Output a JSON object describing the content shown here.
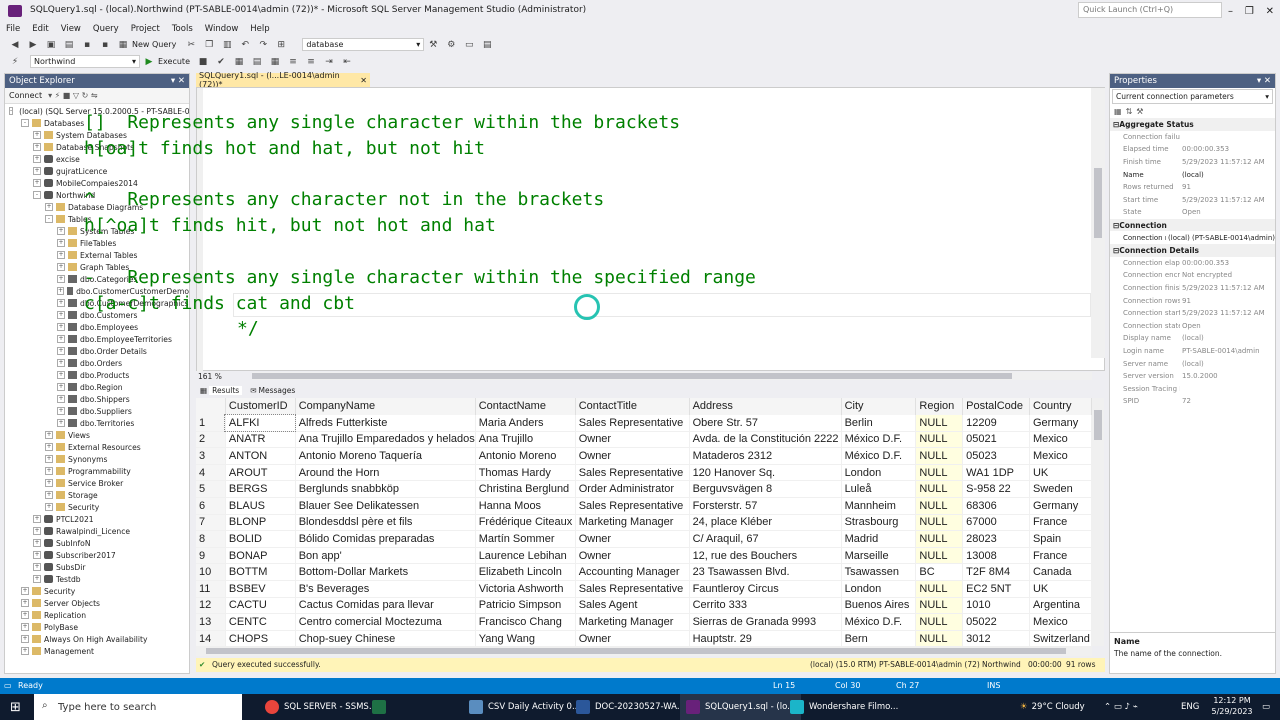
{
  "window": {
    "title": "SQLQuery1.sql - (local).Northwind (PT-SABLE-0014\\admin (72))* - Microsoft SQL Server Management Studio (Administrator)",
    "quick_launch_placeholder": "Quick Launch (Ctrl+Q)"
  },
  "menu": [
    "File",
    "Edit",
    "View",
    "Query",
    "Project",
    "Tools",
    "Window",
    "Help"
  ],
  "toolbar": {
    "new_query": "New Query",
    "database_combo": "database",
    "db_select": "Northwind",
    "execute": "Execute"
  },
  "object_explorer": {
    "title": "Object Explorer",
    "connect": "Connect",
    "tree": [
      {
        "label": "(local) (SQL Server 15.0.2000.5 - PT-SABLE-0014\\admin)",
        "level": 0,
        "exp": "-",
        "icon": "srv"
      },
      {
        "label": "Databases",
        "level": 1,
        "exp": "-",
        "icon": "fold"
      },
      {
        "label": "System Databases",
        "level": 2,
        "exp": "+",
        "icon": "fold"
      },
      {
        "label": "Database Snapshots",
        "level": 2,
        "exp": "+",
        "icon": "fold"
      },
      {
        "label": "excise",
        "level": 2,
        "exp": "+",
        "icon": "db"
      },
      {
        "label": "gujratLicence",
        "level": 2,
        "exp": "+",
        "icon": "db"
      },
      {
        "label": "MobileCompaies2014",
        "level": 2,
        "exp": "+",
        "icon": "db"
      },
      {
        "label": "Northwind",
        "level": 2,
        "exp": "-",
        "icon": "db"
      },
      {
        "label": "Database Diagrams",
        "level": 3,
        "exp": "+",
        "icon": "fold"
      },
      {
        "label": "Tables",
        "level": 3,
        "exp": "-",
        "icon": "fold"
      },
      {
        "label": "System Tables",
        "level": 4,
        "exp": "+",
        "icon": "fold"
      },
      {
        "label": "FileTables",
        "level": 4,
        "exp": "+",
        "icon": "fold"
      },
      {
        "label": "External Tables",
        "level": 4,
        "exp": "+",
        "icon": "fold"
      },
      {
        "label": "Graph Tables",
        "level": 4,
        "exp": "+",
        "icon": "fold"
      },
      {
        "label": "dbo.Categories",
        "level": 4,
        "exp": "+",
        "icon": "tbl"
      },
      {
        "label": "dbo.CustomerCustomerDemo",
        "level": 4,
        "exp": "+",
        "icon": "tbl"
      },
      {
        "label": "dbo.CustomerDemographics",
        "level": 4,
        "exp": "+",
        "icon": "tbl"
      },
      {
        "label": "dbo.Customers",
        "level": 4,
        "exp": "+",
        "icon": "tbl"
      },
      {
        "label": "dbo.Employees",
        "level": 4,
        "exp": "+",
        "icon": "tbl"
      },
      {
        "label": "dbo.EmployeeTerritories",
        "level": 4,
        "exp": "+",
        "icon": "tbl"
      },
      {
        "label": "dbo.Order Details",
        "level": 4,
        "exp": "+",
        "icon": "tbl"
      },
      {
        "label": "dbo.Orders",
        "level": 4,
        "exp": "+",
        "icon": "tbl"
      },
      {
        "label": "dbo.Products",
        "level": 4,
        "exp": "+",
        "icon": "tbl"
      },
      {
        "label": "dbo.Region",
        "level": 4,
        "exp": "+",
        "icon": "tbl"
      },
      {
        "label": "dbo.Shippers",
        "level": 4,
        "exp": "+",
        "icon": "tbl"
      },
      {
        "label": "dbo.Suppliers",
        "level": 4,
        "exp": "+",
        "icon": "tbl"
      },
      {
        "label": "dbo.Territories",
        "level": 4,
        "exp": "+",
        "icon": "tbl"
      },
      {
        "label": "Views",
        "level": 3,
        "exp": "+",
        "icon": "fold"
      },
      {
        "label": "External Resources",
        "level": 3,
        "exp": "+",
        "icon": "fold"
      },
      {
        "label": "Synonyms",
        "level": 3,
        "exp": "+",
        "icon": "fold"
      },
      {
        "label": "Programmability",
        "level": 3,
        "exp": "+",
        "icon": "fold"
      },
      {
        "label": "Service Broker",
        "level": 3,
        "exp": "+",
        "icon": "fold"
      },
      {
        "label": "Storage",
        "level": 3,
        "exp": "+",
        "icon": "fold"
      },
      {
        "label": "Security",
        "level": 3,
        "exp": "+",
        "icon": "fold"
      },
      {
        "label": "PTCL2021",
        "level": 2,
        "exp": "+",
        "icon": "db"
      },
      {
        "label": "Rawalpindi_Licence",
        "level": 2,
        "exp": "+",
        "icon": "db"
      },
      {
        "label": "SubInfoN",
        "level": 2,
        "exp": "+",
        "icon": "db"
      },
      {
        "label": "Subscriber2017",
        "level": 2,
        "exp": "+",
        "icon": "db"
      },
      {
        "label": "SubsDir",
        "level": 2,
        "exp": "+",
        "icon": "db"
      },
      {
        "label": "Testdb",
        "level": 2,
        "exp": "+",
        "icon": "db"
      },
      {
        "label": "Security",
        "level": 1,
        "exp": "+",
        "icon": "fold"
      },
      {
        "label": "Server Objects",
        "level": 1,
        "exp": "+",
        "icon": "fold"
      },
      {
        "label": "Replication",
        "level": 1,
        "exp": "+",
        "icon": "fold"
      },
      {
        "label": "PolyBase",
        "level": 1,
        "exp": "+",
        "icon": "fold"
      },
      {
        "label": "Always On High Availability",
        "level": 1,
        "exp": "+",
        "icon": "fold"
      },
      {
        "label": "Management",
        "level": 1,
        "exp": "+",
        "icon": "fold"
      }
    ]
  },
  "editor": {
    "tab_label": "SQLQuery1.sql - (l...LE-0014\\admin (72))*",
    "lines": [
      "[]  Represents any single character within the brackets",
      "h[oa]t finds hot and hat, but not hit",
      "",
      "^   Represents any character not in the brackets",
      "h[^oa]t finds hit, but not hot and hat",
      "",
      "-   Represents any single character within the specified range",
      "c[a-c]t finds cat and cbt",
      "*/"
    ],
    "zoom": "161 %"
  },
  "results": {
    "tab_results": "Results",
    "tab_messages": "Messages",
    "columns": [
      "CustomerID",
      "CompanyName",
      "ContactName",
      "ContactTitle",
      "Address",
      "City",
      "Region",
      "PostalCode",
      "Country"
    ],
    "rows": [
      [
        "1",
        "ALFKI",
        "Alfreds Futterkiste",
        "Maria Anders",
        "Sales Representative",
        "Obere Str. 57",
        "Berlin",
        "NULL",
        "12209",
        "Germany"
      ],
      [
        "2",
        "ANATR",
        "Ana Trujillo Emparedados y helados",
        "Ana Trujillo",
        "Owner",
        "Avda. de la Constitución 2222",
        "México D.F.",
        "NULL",
        "05021",
        "Mexico"
      ],
      [
        "3",
        "ANTON",
        "Antonio Moreno Taquería",
        "Antonio Moreno",
        "Owner",
        "Mataderos  2312",
        "México D.F.",
        "NULL",
        "05023",
        "Mexico"
      ],
      [
        "4",
        "AROUT",
        "Around the Horn",
        "Thomas Hardy",
        "Sales Representative",
        "120 Hanover Sq.",
        "London",
        "NULL",
        "WA1 1DP",
        "UK"
      ],
      [
        "5",
        "BERGS",
        "Berglunds snabbköp",
        "Christina Berglund",
        "Order Administrator",
        "Berguvsvägen  8",
        "Luleå",
        "NULL",
        "S-958 22",
        "Sweden"
      ],
      [
        "6",
        "BLAUS",
        "Blauer See Delikatessen",
        "Hanna Moos",
        "Sales Representative",
        "Forsterstr. 57",
        "Mannheim",
        "NULL",
        "68306",
        "Germany"
      ],
      [
        "7",
        "BLONP",
        "Blondesddsl père et fils",
        "Frédérique Citeaux",
        "Marketing Manager",
        "24, place Kléber",
        "Strasbourg",
        "NULL",
        "67000",
        "France"
      ],
      [
        "8",
        "BOLID",
        "Bólido Comidas preparadas",
        "Martín Sommer",
        "Owner",
        "C/ Araquil, 67",
        "Madrid",
        "NULL",
        "28023",
        "Spain"
      ],
      [
        "9",
        "BONAP",
        "Bon app'",
        "Laurence Lebihan",
        "Owner",
        "12, rue des Bouchers",
        "Marseille",
        "NULL",
        "13008",
        "France"
      ],
      [
        "10",
        "BOTTM",
        "Bottom-Dollar Markets",
        "Elizabeth Lincoln",
        "Accounting Manager",
        "23 Tsawassen Blvd.",
        "Tsawassen",
        "BC",
        "T2F 8M4",
        "Canada"
      ],
      [
        "11",
        "BSBEV",
        "B's Beverages",
        "Victoria Ashworth",
        "Sales Representative",
        "Fauntleroy Circus",
        "London",
        "NULL",
        "EC2 5NT",
        "UK"
      ],
      [
        "12",
        "CACTU",
        "Cactus Comidas para llevar",
        "Patricio Simpson",
        "Sales Agent",
        "Cerrito 333",
        "Buenos Aires",
        "NULL",
        "1010",
        "Argentina"
      ],
      [
        "13",
        "CENTC",
        "Centro comercial Moctezuma",
        "Francisco Chang",
        "Marketing Manager",
        "Sierras de Granada 9993",
        "México D.F.",
        "NULL",
        "05022",
        "Mexico"
      ],
      [
        "14",
        "CHOPS",
        "Chop-suey Chinese",
        "Yang Wang",
        "Owner",
        "Hauptstr. 29",
        "Bern",
        "NULL",
        "3012",
        "Switzerland"
      ]
    ]
  },
  "query_status": {
    "message": "Query executed successfully.",
    "server": "(local) (15.0 RTM)",
    "user": "PT-SABLE-0014\\admin (72)",
    "database": "Northwind",
    "elapsed": "00:00:00",
    "rows": "91 rows"
  },
  "properties": {
    "title": "Properties",
    "selector": "Current connection parameters",
    "sections": [
      {
        "name": "Aggregate Status",
        "items": [
          [
            "Connection failures",
            ""
          ],
          [
            "Elapsed time",
            "00:00:00.353"
          ],
          [
            "Finish time",
            "5/29/2023 11:57:12 AM"
          ],
          [
            "Name",
            "(local)"
          ],
          [
            "Rows returned",
            "91"
          ],
          [
            "Start time",
            "5/29/2023 11:57:12 AM"
          ],
          [
            "State",
            "Open"
          ]
        ]
      },
      {
        "name": "Connection",
        "items": [
          [
            "Connection name",
            "(local) (PT-SABLE-0014\\admin)"
          ]
        ]
      },
      {
        "name": "Connection Details",
        "items": [
          [
            "Connection elapsed",
            "00:00:00.353"
          ],
          [
            "Connection encryption",
            "Not encrypted"
          ],
          [
            "Connection finish time",
            "5/29/2023 11:57:12 AM"
          ],
          [
            "Connection rows returned",
            "91"
          ],
          [
            "Connection start time",
            "5/29/2023 11:57:12 AM"
          ],
          [
            "Connection state",
            "Open"
          ],
          [
            "Display name",
            "(local)"
          ],
          [
            "Login name",
            "PT-SABLE-0014\\admin"
          ],
          [
            "Server name",
            "(local)"
          ],
          [
            "Server version",
            "15.0.2000"
          ],
          [
            "Session Tracing ID",
            ""
          ],
          [
            "SPID",
            "72"
          ]
        ]
      }
    ],
    "desc_title": "Name",
    "desc_text": "The name of the connection."
  },
  "app_status": {
    "ready": "Ready",
    "ln": "Ln 15",
    "col": "Col 30",
    "ch": "Ch 27",
    "ins": "INS"
  },
  "taskbar": {
    "search_placeholder": "Type here to search",
    "apps": [
      "SQL SERVER - SSMS...",
      "CSV Daily Activity 0...",
      "DOC-20230527-WA...",
      "SQLQuery1.sql - (lo...",
      "Wondershare Filmo..."
    ],
    "weather": "29°C  Cloudy",
    "lang": "ENG",
    "time": "12:12 PM",
    "date": "5/29/2023"
  }
}
